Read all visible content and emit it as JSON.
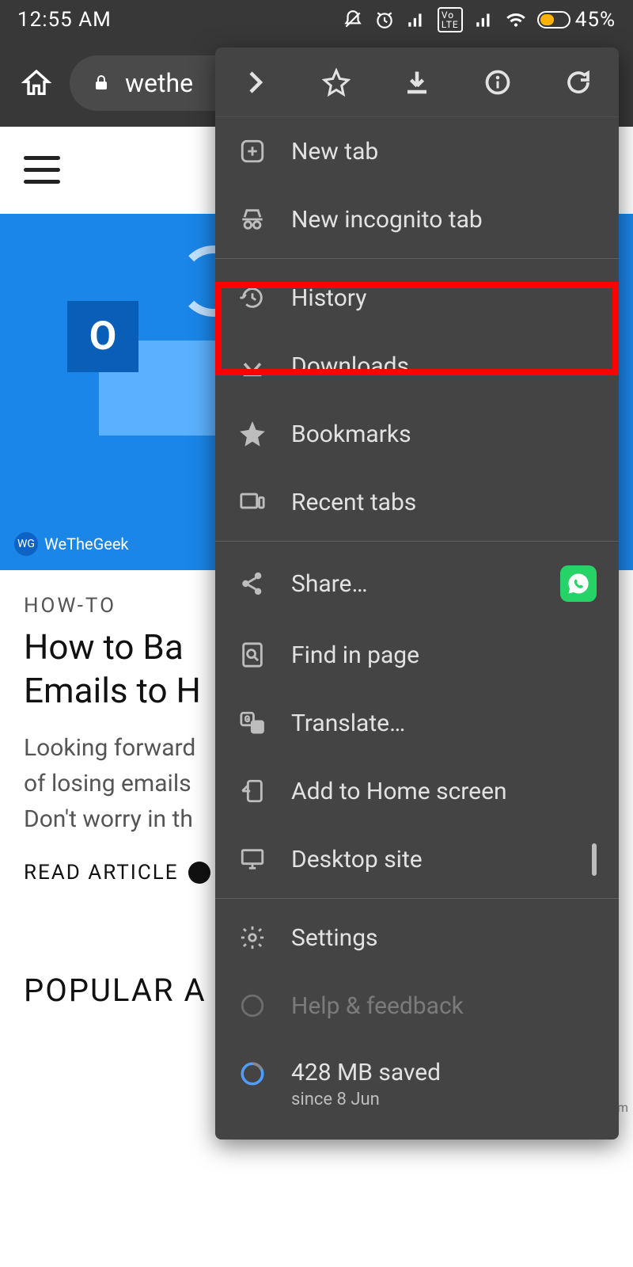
{
  "status": {
    "time": "12:55 AM",
    "battery": "45%"
  },
  "url_bar": {
    "domain": "wethe"
  },
  "page": {
    "logo_letter": "O",
    "brand": "WeTheGeek",
    "brand_short": "WG",
    "category": "HOW-TO",
    "title_line1": "How to Ba",
    "title_line2": "Emails to H",
    "excerpt_line1": "Looking forward",
    "excerpt_line2": "of losing emails",
    "excerpt_line3": "Don't worry in th",
    "read_label": "READ ARTICLE",
    "popular_label": "POPULAR A",
    "watermark": "wsxdn.com"
  },
  "menu": {
    "items": {
      "new_tab": "New tab",
      "incognito": "New incognito tab",
      "history": "History",
      "downloads": "Downloads",
      "bookmarks": "Bookmarks",
      "recent_tabs": "Recent tabs",
      "share": "Share…",
      "find": "Find in page",
      "translate": "Translate…",
      "add_home": "Add to Home screen",
      "desktop": "Desktop site",
      "settings": "Settings",
      "help": "Help & feedback",
      "saved": "428 MB saved",
      "saved_sub": "since 8 Jun"
    }
  }
}
